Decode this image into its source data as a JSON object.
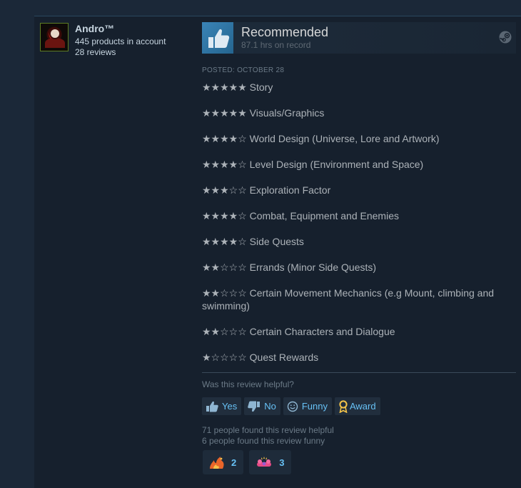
{
  "author": {
    "name": "Andro™",
    "products": "445 products in account",
    "reviews": "28 reviews"
  },
  "rating": {
    "title": "Recommended",
    "hours": "87.1 hrs on record"
  },
  "posted": "POSTED: OCTOBER 28",
  "review_lines": [
    "★★★★★ Story",
    "★★★★★ Visuals/Graphics",
    "★★★★☆ World Design (Universe, Lore and Artwork)",
    "★★★★☆ Level Design (Environment and Space)",
    "★★★☆☆ Exploration Factor",
    "★★★★☆ Combat, Equipment and Enemies",
    "★★★★☆ Side Quests",
    "★★☆☆☆ Errands (Minor Side Quests)",
    "★★☆☆☆ Certain Movement Mechanics (e.g Mount, climbing and swimming)",
    "★★☆☆☆ Certain Characters and Dialogue",
    "★☆☆☆☆ Quest Rewards"
  ],
  "helpful": {
    "question": "Was this review helpful?",
    "yes": "Yes",
    "no": "No",
    "funny": "Funny",
    "award": "Award",
    "helpful_count": "71 people found this review helpful",
    "funny_count": "6 people found this review funny"
  },
  "awards": [
    {
      "icon": "fire-award-icon",
      "count": "2"
    },
    {
      "icon": "clap-award-icon",
      "count": "3"
    }
  ],
  "colors": {
    "accent": "#67c1f5",
    "background": "#1b2838",
    "card": "#16202d"
  }
}
